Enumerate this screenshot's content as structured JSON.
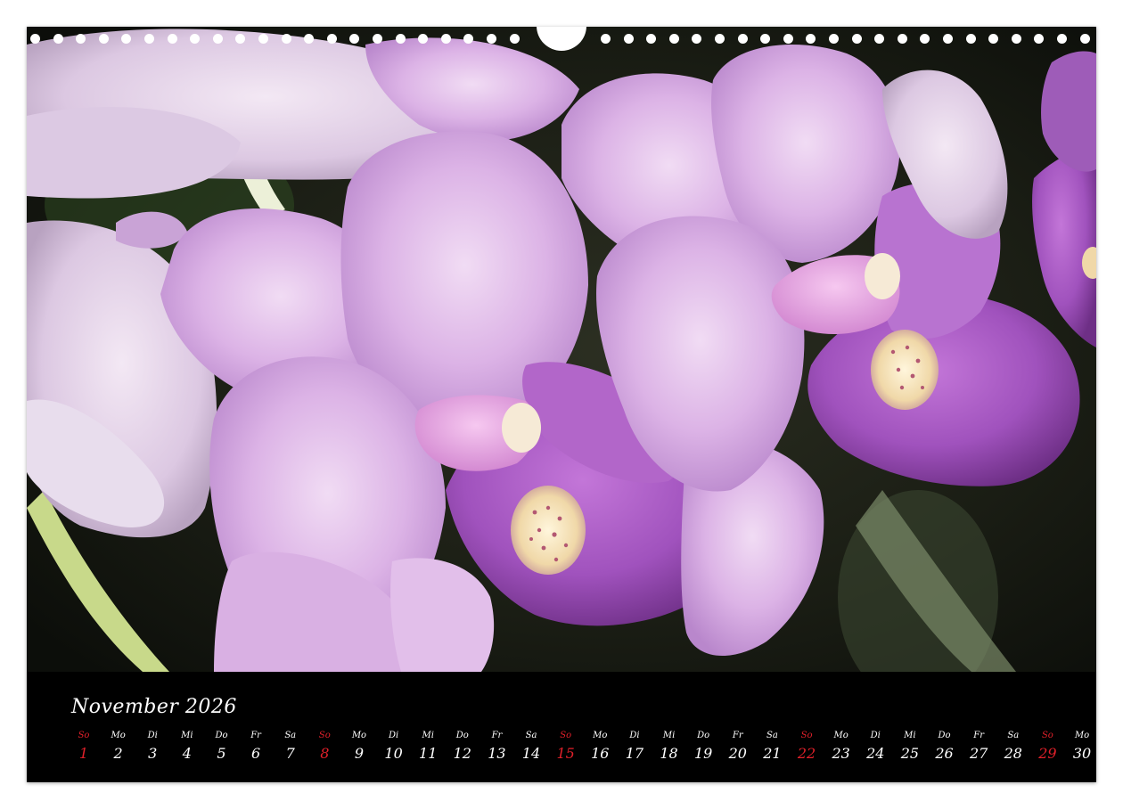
{
  "calendar": {
    "title": "November 2026",
    "days": [
      {
        "wd": "So",
        "d": "1",
        "sunday": true
      },
      {
        "wd": "Mo",
        "d": "2"
      },
      {
        "wd": "Di",
        "d": "3"
      },
      {
        "wd": "Mi",
        "d": "4"
      },
      {
        "wd": "Do",
        "d": "5"
      },
      {
        "wd": "Fr",
        "d": "6"
      },
      {
        "wd": "Sa",
        "d": "7"
      },
      {
        "wd": "So",
        "d": "8",
        "sunday": true
      },
      {
        "wd": "Mo",
        "d": "9"
      },
      {
        "wd": "Di",
        "d": "10"
      },
      {
        "wd": "Mi",
        "d": "11"
      },
      {
        "wd": "Do",
        "d": "12"
      },
      {
        "wd": "Fr",
        "d": "13"
      },
      {
        "wd": "Sa",
        "d": "14"
      },
      {
        "wd": "So",
        "d": "15",
        "sunday": true
      },
      {
        "wd": "Mo",
        "d": "16"
      },
      {
        "wd": "Di",
        "d": "17"
      },
      {
        "wd": "Mi",
        "d": "18"
      },
      {
        "wd": "Do",
        "d": "19"
      },
      {
        "wd": "Fr",
        "d": "20"
      },
      {
        "wd": "Sa",
        "d": "21"
      },
      {
        "wd": "So",
        "d": "22",
        "sunday": true
      },
      {
        "wd": "Mo",
        "d": "23"
      },
      {
        "wd": "Di",
        "d": "24"
      },
      {
        "wd": "Mi",
        "d": "25"
      },
      {
        "wd": "Do",
        "d": "26"
      },
      {
        "wd": "Fr",
        "d": "27"
      },
      {
        "wd": "Sa",
        "d": "28"
      },
      {
        "wd": "So",
        "d": "29",
        "sunday": true
      },
      {
        "wd": "Mo",
        "d": "30"
      }
    ]
  },
  "photo": {
    "subject": "orchid-flowers-icon",
    "colors": {
      "petal_light": "#e4c4ec",
      "petal_mid": "#c58ad6",
      "lip": "#a24fbf",
      "background": "#1d2216",
      "stem": "#c8d98a",
      "sunday_red": "#e0202a"
    }
  }
}
